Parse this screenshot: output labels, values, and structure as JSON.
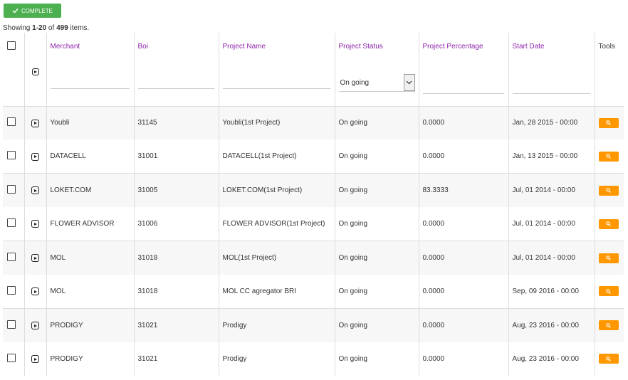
{
  "toolbar": {
    "complete_label": "COMPLETE"
  },
  "summary": {
    "prefix": "Showing ",
    "range": "1-20",
    "of": " of ",
    "total": "499",
    "suffix": " items."
  },
  "columns": {
    "merchant": "Merchant",
    "boi": "Boi",
    "project_name": "Project Name",
    "project_status": "Project Status",
    "project_percentage": "Project Percentage",
    "start_date": "Start Date",
    "tools": "Tools"
  },
  "filters": {
    "project_status_selected": "On going"
  },
  "colors": {
    "accent": "#8e24aa",
    "complete": "#4caf50",
    "search": "#ff9800"
  },
  "rows": [
    {
      "merchant": "Youbli",
      "boi": "31145",
      "project_name": "Youbli(1st Project)",
      "status": "On going",
      "percentage": "0.0000",
      "start_date": "Jan, 28 2015 - 00:00"
    },
    {
      "merchant": "DATACELL",
      "boi": "31001",
      "project_name": "DATACELL(1st Project)",
      "status": "On going",
      "percentage": "0.0000",
      "start_date": "Jan, 13 2015 - 00:00"
    },
    {
      "merchant": "LOKET.COM",
      "boi": "31005",
      "project_name": "LOKET.COM(1st Project)",
      "status": "On going",
      "percentage": "83.3333",
      "start_date": "Jul, 01 2014 - 00:00"
    },
    {
      "merchant": "FLOWER ADVISOR",
      "boi": "31006",
      "project_name": "FLOWER ADVISOR(1st Project)",
      "status": "On going",
      "percentage": "0.0000",
      "start_date": "Jul, 01 2014 - 00:00"
    },
    {
      "merchant": "MOL",
      "boi": "31018",
      "project_name": "MOL(1st Project)",
      "status": "On going",
      "percentage": "0.0000",
      "start_date": "Jul, 01 2014 - 00:00"
    },
    {
      "merchant": "MOL",
      "boi": "31018",
      "project_name": "MOL CC agregator BRI",
      "status": "On going",
      "percentage": "0.0000",
      "start_date": "Sep, 09 2016 - 00:00"
    },
    {
      "merchant": "PRODIGY",
      "boi": "31021",
      "project_name": "Prodigy",
      "status": "On going",
      "percentage": "0.0000",
      "start_date": "Aug, 23 2016 - 00:00"
    },
    {
      "merchant": "PRODIGY",
      "boi": "31021",
      "project_name": "Prodigy",
      "status": "On going",
      "percentage": "0.0000",
      "start_date": "Aug, 23 2016 - 00:00"
    }
  ]
}
